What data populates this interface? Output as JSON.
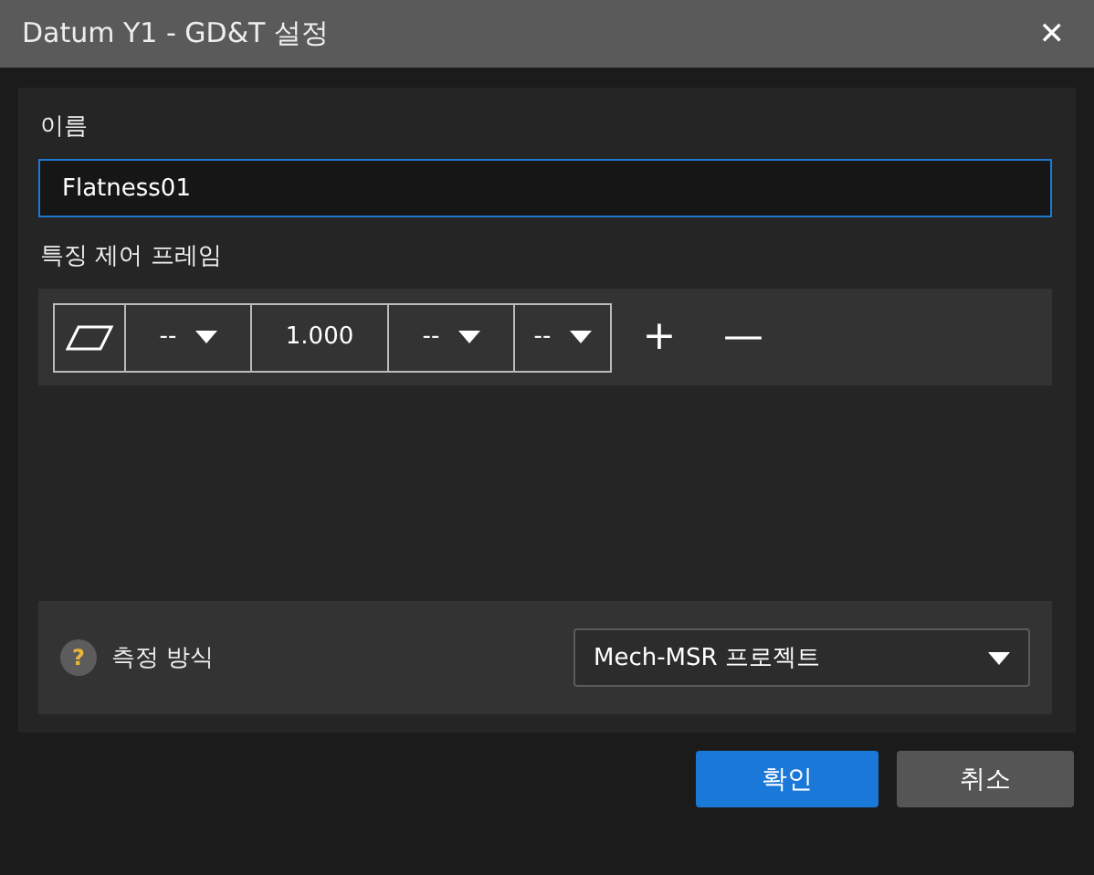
{
  "window": {
    "title": "Datum Y1 - GD&T 설정",
    "close": "✕"
  },
  "name_label": "이름",
  "name_field": {
    "value": "Flatness01"
  },
  "frame_label": "특징 제어 프레임",
  "frame_cells": [
    {
      "kind": "symbol"
    },
    {
      "kind": "dropdown",
      "value": "--"
    },
    {
      "kind": "value",
      "value": "1.000"
    },
    {
      "kind": "dropdown",
      "value": "--"
    },
    {
      "kind": "dropdown",
      "value": "--"
    }
  ],
  "frame_actions": [
    "+",
    "—"
  ],
  "measure": {
    "help": "?",
    "label": "측정 방식",
    "value": "Mech-MSR 프로젝트"
  },
  "buttons": [
    {
      "label": "확인",
      "kind": "primary"
    },
    {
      "label": "취소",
      "kind": "secondary"
    }
  ]
}
